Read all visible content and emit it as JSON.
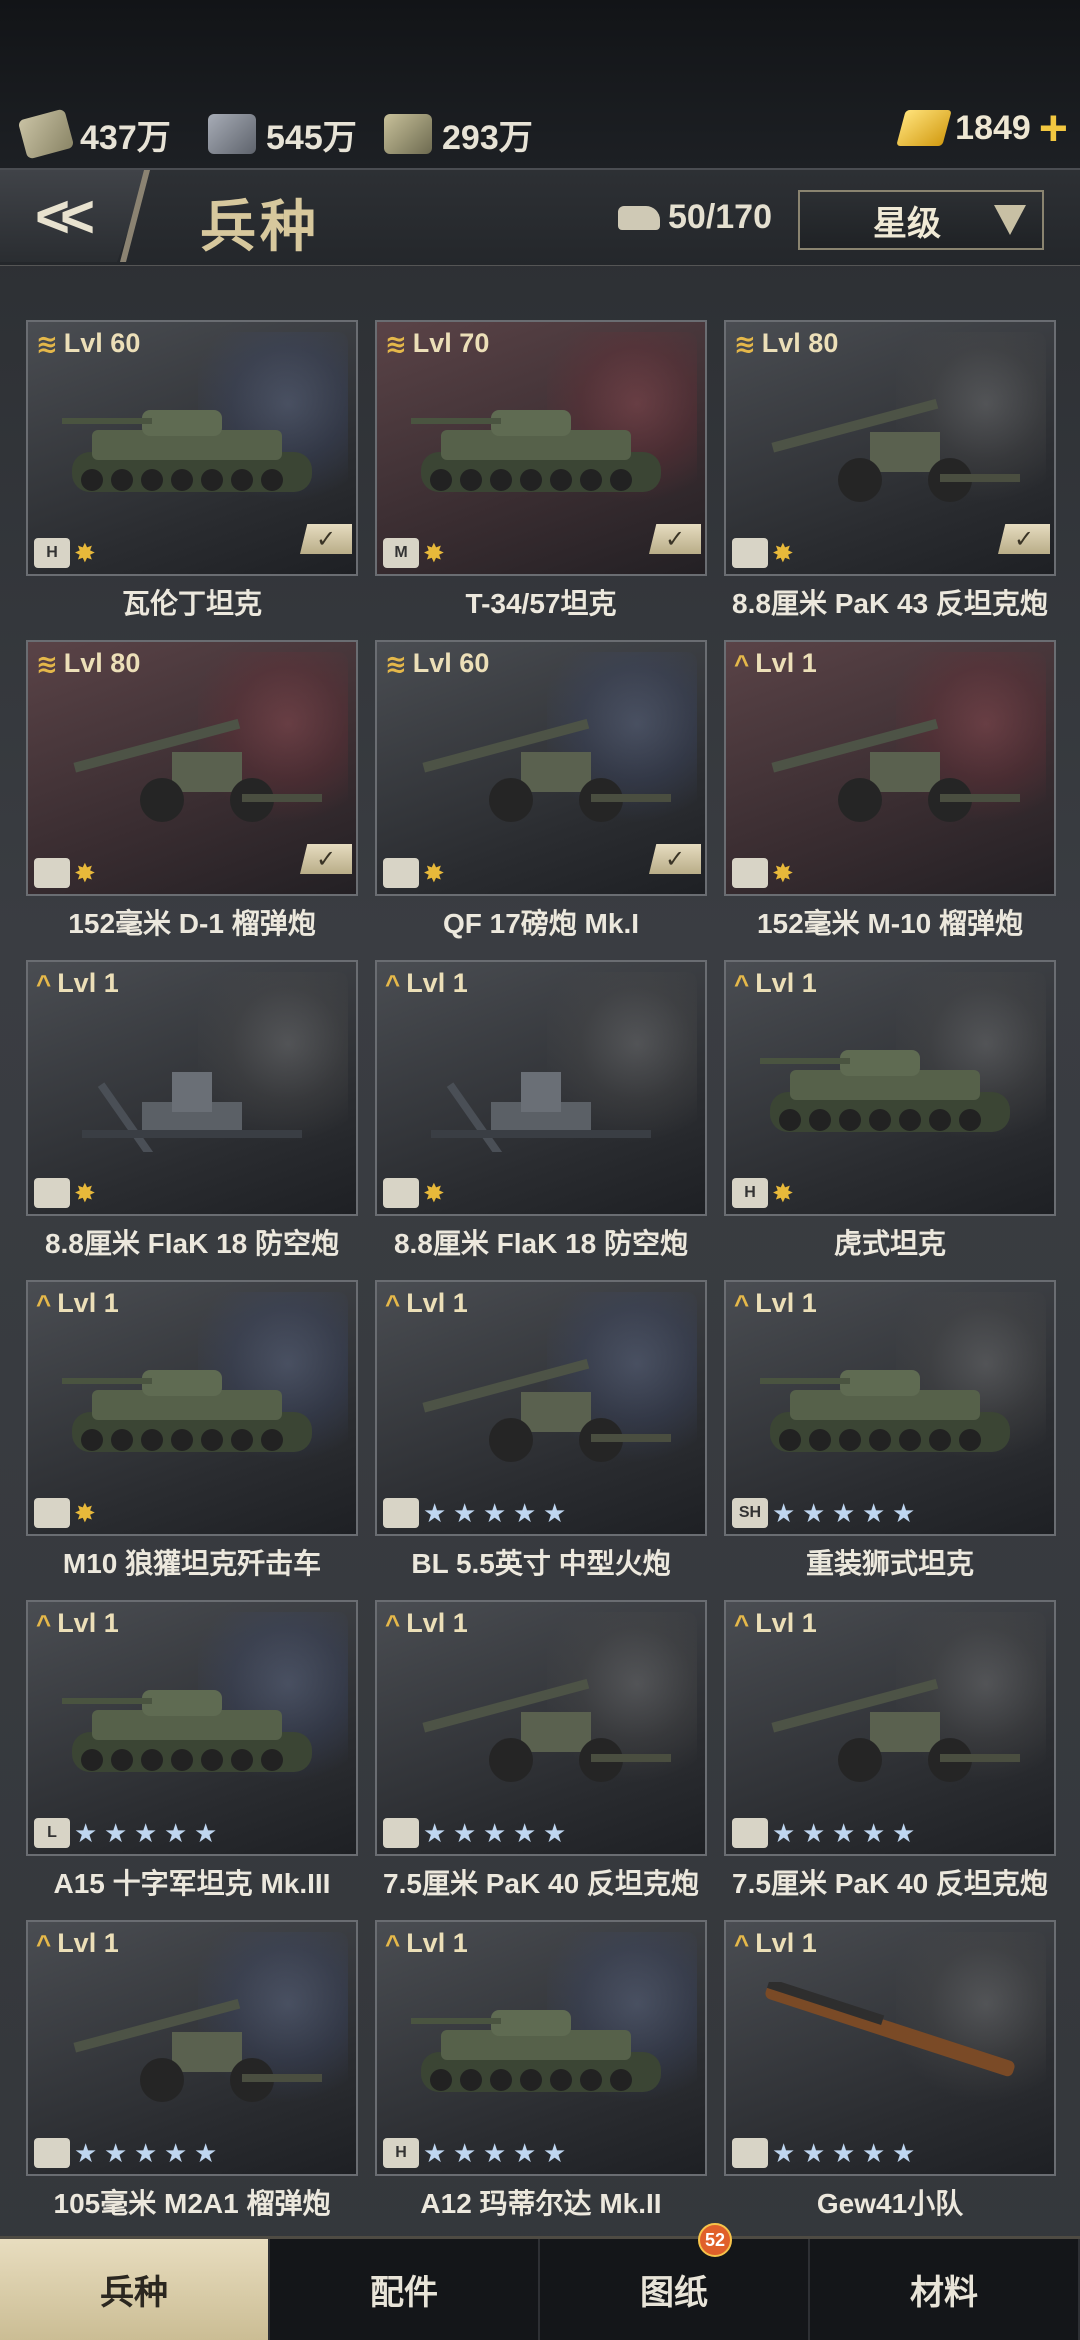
{
  "resources": {
    "cash": "437万",
    "steel": "545万",
    "oil": "293万",
    "gold": "1849"
  },
  "header": {
    "title": "兵种",
    "unit_count": "50/170",
    "sort_label": "星级"
  },
  "units": [
    {
      "level": "Lvl 60",
      "name": "瓦伦丁坦克",
      "type_icon": "H",
      "theme": "blue",
      "owned": true,
      "rank": "sergeant",
      "stars": 0
    },
    {
      "level": "Lvl 70",
      "name": "T-34/57坦克",
      "type_icon": "M",
      "theme": "red",
      "owned": true,
      "rank": "sergeant",
      "stars": 0
    },
    {
      "level": "Lvl 80",
      "name": "8.8厘米 PaK 43 反坦克炮",
      "type_icon": "AT",
      "theme": "grey",
      "owned": true,
      "rank": "sergeant",
      "stars": 0
    },
    {
      "level": "Lvl 80",
      "name": "152毫米 D-1 榴弹炮",
      "type_icon": "ART",
      "theme": "red",
      "owned": true,
      "rank": "sergeant",
      "stars": 0
    },
    {
      "level": "Lvl 60",
      "name": "QF 17磅炮 Mk.I",
      "type_icon": "ART",
      "theme": "blue",
      "owned": true,
      "rank": "sergeant",
      "stars": 0
    },
    {
      "level": "Lvl 1",
      "name": "152毫米 M-10 榴弹炮",
      "type_icon": "ART",
      "theme": "red",
      "owned": false,
      "rank": "private",
      "stars": 0
    },
    {
      "level": "Lvl 1",
      "name": "8.8厘米 FlaK 18 防空炮",
      "type_icon": "AA",
      "theme": "grey",
      "owned": false,
      "rank": "private",
      "stars": 0
    },
    {
      "level": "Lvl 1",
      "name": "8.8厘米 FlaK 18 防空炮",
      "type_icon": "AA",
      "theme": "grey",
      "owned": false,
      "rank": "private",
      "stars": 0
    },
    {
      "level": "Lvl 1",
      "name": "虎式坦克",
      "type_icon": "H",
      "theme": "grey",
      "owned": false,
      "rank": "private",
      "stars": 0
    },
    {
      "level": "Lvl 1",
      "name": "M10 狼獾坦克歼击车",
      "type_icon": "TD",
      "theme": "blue",
      "owned": false,
      "rank": "private",
      "stars": 0
    },
    {
      "level": "Lvl 1",
      "name": "BL 5.5英寸 中型火炮",
      "type_icon": "ART",
      "theme": "blue",
      "owned": false,
      "rank": "private",
      "stars": 5
    },
    {
      "level": "Lvl 1",
      "name": "重装狮式坦克",
      "type_icon": "SH",
      "theme": "grey",
      "owned": false,
      "rank": "private",
      "stars": 5
    },
    {
      "level": "Lvl 1",
      "name": "A15 十字军坦克 Mk.III",
      "type_icon": "L",
      "theme": "blue",
      "owned": false,
      "rank": "private",
      "stars": 5
    },
    {
      "level": "Lvl 1",
      "name": "7.5厘米 PaK 40 反坦克炮",
      "type_icon": "AT",
      "theme": "grey",
      "owned": false,
      "rank": "private",
      "stars": 5
    },
    {
      "level": "Lvl 1",
      "name": "7.5厘米 PaK 40 反坦克炮",
      "type_icon": "AT",
      "theme": "grey",
      "owned": false,
      "rank": "private",
      "stars": 5
    },
    {
      "level": "Lvl 1",
      "name": "105毫米 M2A1 榴弹炮",
      "type_icon": "ART",
      "theme": "blue",
      "owned": false,
      "rank": "private",
      "stars": 5
    },
    {
      "level": "Lvl 1",
      "name": "A12 玛蒂尔达 Mk.II",
      "type_icon": "H",
      "theme": "blue",
      "owned": false,
      "rank": "private",
      "stars": 5
    },
    {
      "level": "Lvl 1",
      "name": "Gew41小队",
      "type_icon": "INF",
      "theme": "grey",
      "owned": false,
      "rank": "private",
      "stars": 5
    }
  ],
  "tabs": [
    {
      "label": "兵种",
      "active": true
    },
    {
      "label": "配件",
      "active": false
    },
    {
      "label": "图纸",
      "active": false,
      "badge": "52"
    },
    {
      "label": "材料",
      "active": false
    }
  ]
}
